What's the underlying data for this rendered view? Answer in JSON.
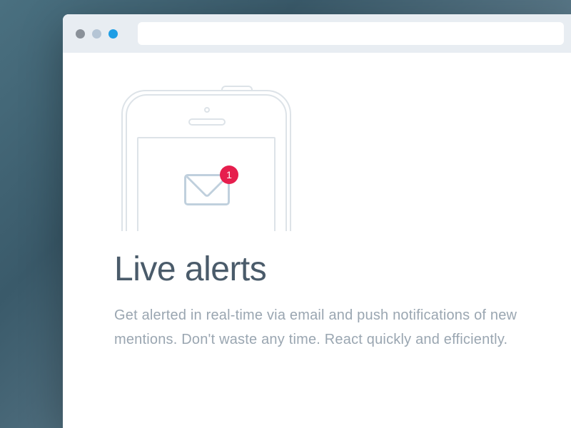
{
  "content": {
    "heading": "Live alerts",
    "description": "Get alerted in real-time via email and push notifications of new mentions. Don't waste any time. React quickly and efficiently.",
    "badge_count": "1"
  },
  "icons": {
    "envelope": "envelope-icon",
    "notification_badge": "notification-badge"
  },
  "colors": {
    "badge": "#e61e4d",
    "heading": "#4a5b6a",
    "description": "#9aa6b1",
    "illustration_stroke": "#dde3e8",
    "envelope_stroke": "#c0d0dd"
  }
}
